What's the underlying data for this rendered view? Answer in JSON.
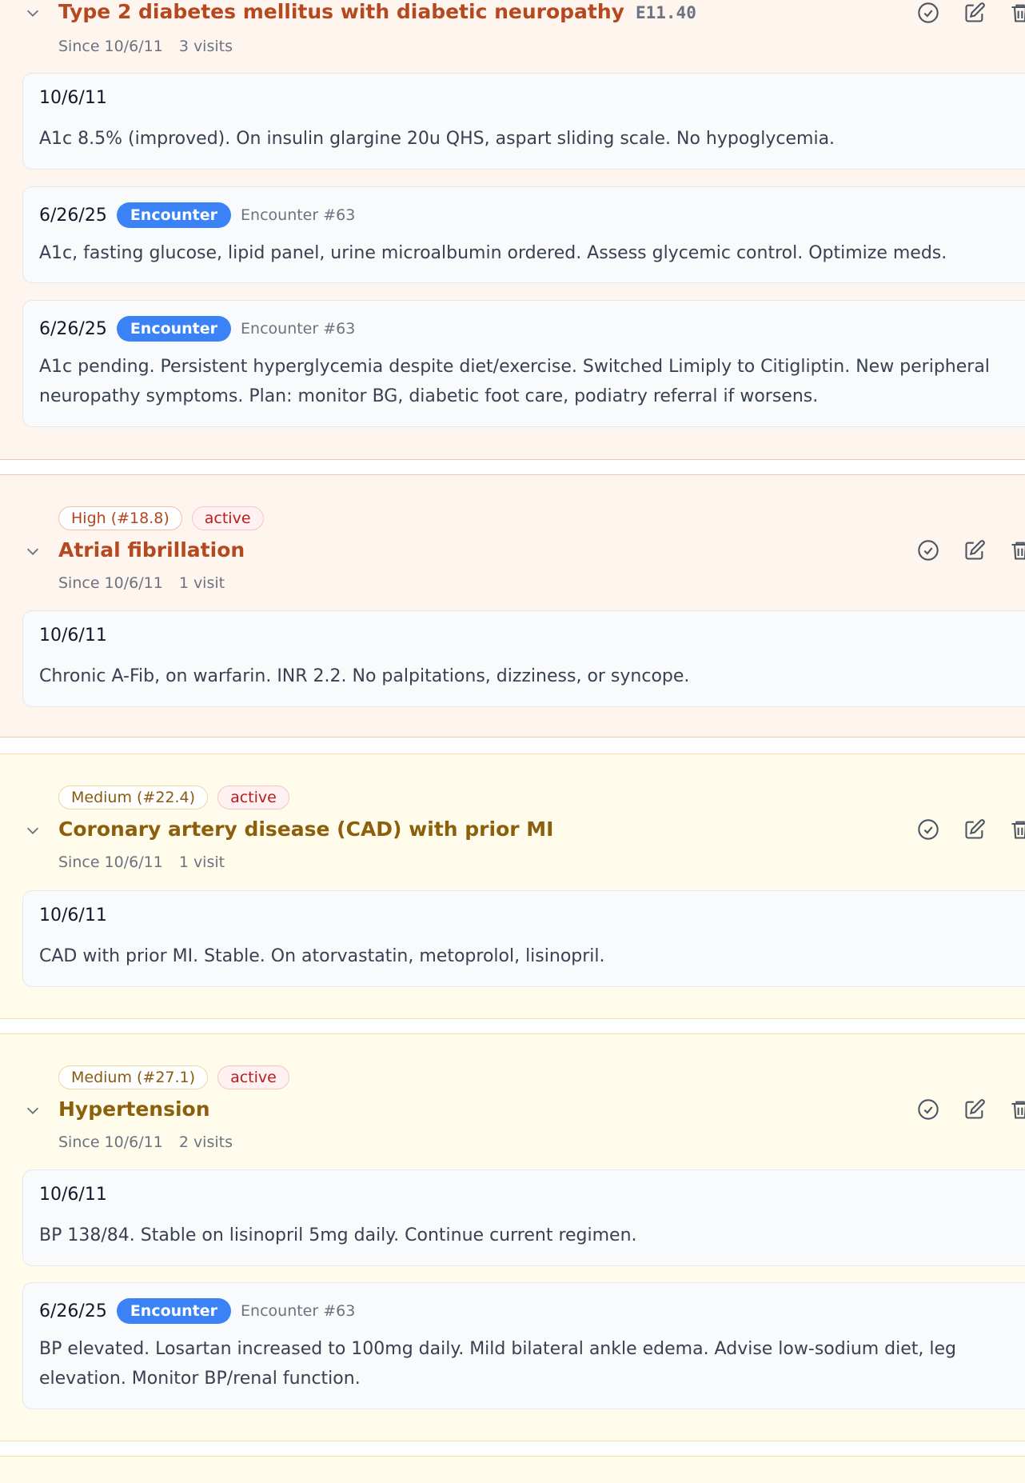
{
  "problems": [
    {
      "title": "Type 2 diabetes mellitus with diabetic neuropathy",
      "code": "E11.40",
      "since": "Since 10/6/11",
      "visits": "3 visits",
      "notes": [
        {
          "date": "10/6/11",
          "text": "A1c 8.5% (improved). On insulin glargine 20u QHS, aspart sliding scale. No hypoglycemia."
        },
        {
          "date": "6/26/25",
          "badge": "Encounter",
          "ref": "Encounter #63",
          "text": "A1c, fasting glucose, lipid panel, urine microalbumin ordered. Assess glycemic control. Optimize meds."
        },
        {
          "date": "6/26/25",
          "badge": "Encounter",
          "ref": "Encounter #63",
          "text": "A1c pending. Persistent hyperglycemia despite diet/exercise. Switched Limiply to Citigliptin. New peripheral neuropathy symptoms. Plan: monitor BG, diabetic foot care, podiatry referral if worsens."
        }
      ]
    },
    {
      "priority": "High (#18.8)",
      "status": "active",
      "title": "Atrial fibrillation",
      "since": "Since 10/6/11",
      "visits": "1 visit",
      "notes": [
        {
          "date": "10/6/11",
          "text": "Chronic A-Fib, on warfarin. INR 2.2. No palpitations, dizziness, or syncope."
        }
      ]
    },
    {
      "priority": "Medium (#22.4)",
      "status": "active",
      "title": "Coronary artery disease (CAD) with prior MI",
      "since": "Since 10/6/11",
      "visits": "1 visit",
      "notes": [
        {
          "date": "10/6/11",
          "text": "CAD with prior MI. Stable. On atorvastatin, metoprolol, lisinopril."
        }
      ]
    },
    {
      "priority": "Medium (#27.1)",
      "status": "active",
      "title": "Hypertension",
      "since": "Since 10/6/11",
      "visits": "2 visits",
      "notes": [
        {
          "date": "10/6/11",
          "text": "BP 138/84. Stable on lisinopril 5mg daily. Continue current regimen."
        },
        {
          "date": "6/26/25",
          "badge": "Encounter",
          "ref": "Encounter #63",
          "text": "BP elevated. Losartan increased to 100mg daily. Mild bilateral ankle edema. Advise low-sodium diet, leg elevation. Monitor BP/renal function."
        }
      ]
    }
  ],
  "icons": {
    "collapse": "chevron-down-icon",
    "resolve": "check-circle-icon",
    "edit": "edit-icon",
    "delete": "trash-icon"
  },
  "colors": {
    "high_title": "#b5481f",
    "medium_title": "#8c5f0d",
    "encounter_badge": "#3b82f6",
    "active_status": "#b91c1c"
  }
}
